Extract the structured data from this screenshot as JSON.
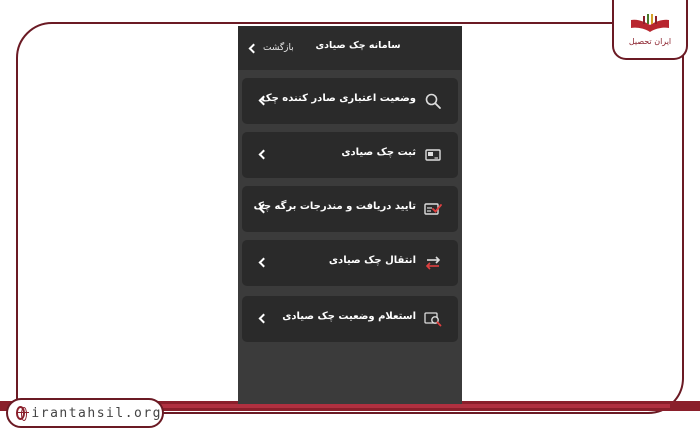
{
  "app": {
    "title": "سامانه چک صیادی",
    "back_label": "بازگشت"
  },
  "menu": [
    {
      "label": "وضعیت اعتباری صادر کننده چک",
      "icon": "search-icon"
    },
    {
      "label": "ثبت چک صیادی",
      "icon": "register-check-icon"
    },
    {
      "label": "تایید دریافت و مندرجات برگه چک",
      "icon": "check-approve-icon"
    },
    {
      "label": "انتقال چک صیادی",
      "icon": "transfer-arrows-icon"
    },
    {
      "label": "استعلام وضعیت چک صیادی",
      "icon": "inquiry-search-icon"
    }
  ],
  "branding": {
    "logo_text": "ایران تحصیل",
    "website": "irantahsil.org"
  },
  "colors": {
    "screen_bg": "#3b3b3b",
    "item_bg": "#2a2a2a",
    "brand": "#8a1f2b",
    "accent_red": "#e04040"
  }
}
